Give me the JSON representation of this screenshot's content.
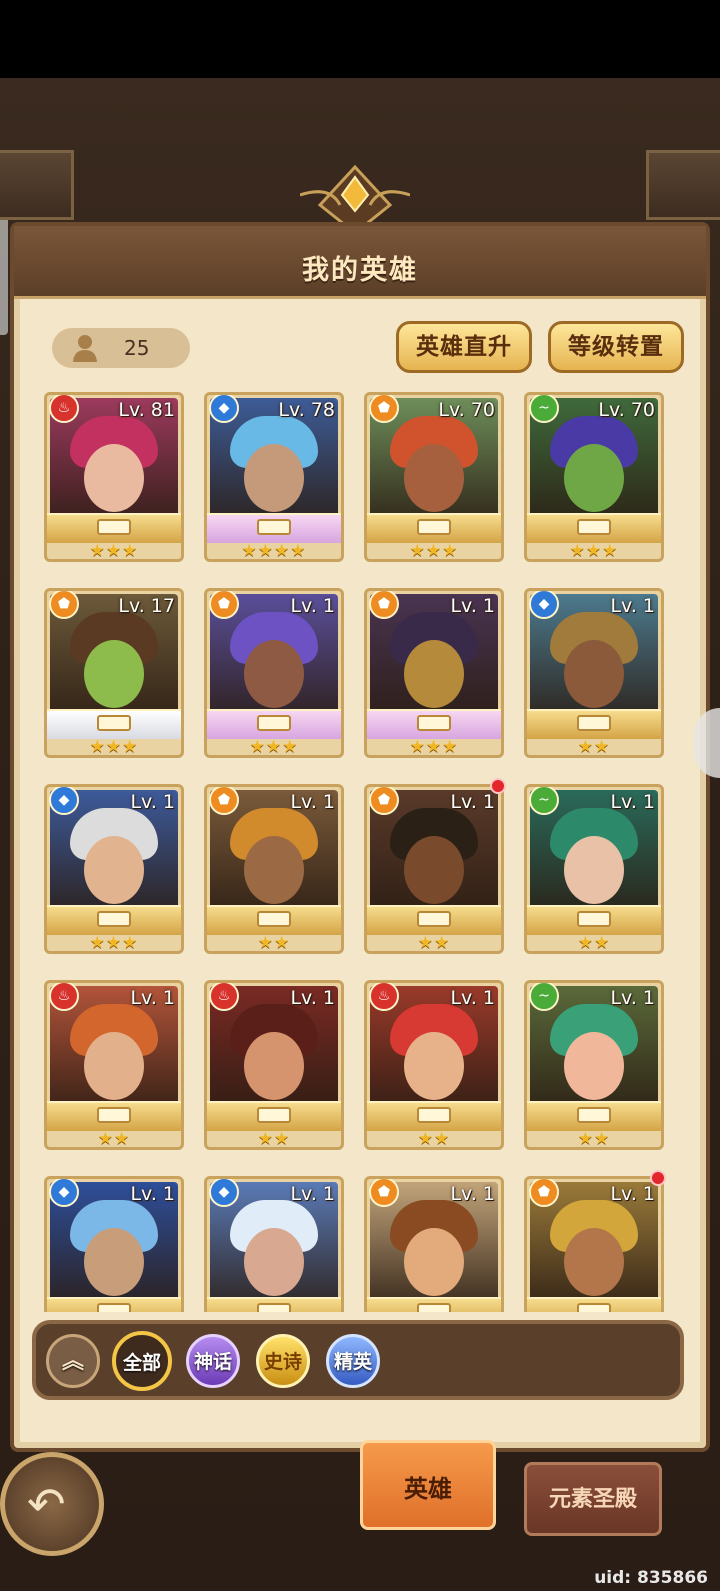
{
  "header": {
    "title": "我的英雄"
  },
  "roster": {
    "count": "25"
  },
  "actions": {
    "direct_upgrade": "英雄直升",
    "level_transfer": "等级转置"
  },
  "heroes": [
    {
      "level": "Lv. 81",
      "element": "fire",
      "stars": "★★★",
      "base": "gold",
      "colors": {
        "bg": "#9c3a5d",
        "hair": "#c2315f",
        "skin": "#e9b9a0"
      }
    },
    {
      "level": "Lv. 78",
      "element": "water",
      "stars": "★★★★",
      "base": "pink",
      "colors": {
        "bg": "#3d5c97",
        "hair": "#68b9e6",
        "skin": "#c49a7a"
      }
    },
    {
      "level": "Lv. 70",
      "element": "light",
      "stars": "★★★",
      "base": "gold",
      "colors": {
        "bg": "#6e8e5a",
        "hair": "#d0532e",
        "skin": "#a7603e"
      }
    },
    {
      "level": "Lv. 70",
      "element": "wind",
      "stars": "★★★",
      "base": "gold",
      "colors": {
        "bg": "#3f6a3c",
        "hair": "#4a3aa5",
        "skin": "#6fa746"
      }
    },
    {
      "level": "Lv. 17",
      "element": "light",
      "stars": "★★★",
      "base": "white",
      "colors": {
        "bg": "#6d5a3a",
        "hair": "#5a3a22",
        "skin": "#8dbb4c"
      }
    },
    {
      "level": "Lv. 1",
      "element": "light",
      "stars": "★★★",
      "base": "pink",
      "colors": {
        "bg": "#5a4f9a",
        "hair": "#6d52c4",
        "skin": "#8e5a43"
      }
    },
    {
      "level": "Lv. 1",
      "element": "light",
      "stars": "★★★",
      "base": "pink",
      "colors": {
        "bg": "#4a3452",
        "hair": "#3a2a4a",
        "skin": "#b58a3a"
      }
    },
    {
      "level": "Lv. 1",
      "element": "water",
      "stars": "★★",
      "base": "gold",
      "colors": {
        "bg": "#4c7a8e",
        "hair": "#a07b3c",
        "skin": "#8a5a3a"
      }
    },
    {
      "level": "Lv. 1",
      "element": "water",
      "stars": "★★★",
      "base": "gold",
      "colors": {
        "bg": "#3d5a9a",
        "hair": "#dcdcdc",
        "skin": "#e1b38f"
      }
    },
    {
      "level": "Lv. 1",
      "element": "light",
      "stars": "★★",
      "base": "gold",
      "colors": {
        "bg": "#7a5a3a",
        "hair": "#d18a2c",
        "skin": "#9b6a45"
      }
    },
    {
      "level": "Lv. 1",
      "element": "light",
      "stars": "★★",
      "base": "gold",
      "colors": {
        "bg": "#5a3a2a",
        "hair": "#2a2016",
        "skin": "#7a4a2c"
      },
      "alert": true
    },
    {
      "level": "Lv. 1",
      "element": "wind",
      "stars": "★★",
      "base": "gold",
      "colors": {
        "bg": "#2a6a5a",
        "hair": "#2c8a6a",
        "skin": "#e9c1a6"
      }
    },
    {
      "level": "Lv. 1",
      "element": "fire",
      "stars": "★★",
      "base": "gold",
      "colors": {
        "bg": "#b2543a",
        "hair": "#d2662c",
        "skin": "#e2b08a"
      }
    },
    {
      "level": "Lv. 1",
      "element": "fire",
      "stars": "★★",
      "base": "gold",
      "colors": {
        "bg": "#7a2a24",
        "hair": "#5a1f18",
        "skin": "#d6946e"
      }
    },
    {
      "level": "Lv. 1",
      "element": "fire",
      "stars": "★★",
      "base": "gold",
      "colors": {
        "bg": "#9a3a2a",
        "hair": "#d63a32",
        "skin": "#e7b28a"
      }
    },
    {
      "level": "Lv. 1",
      "element": "wind",
      "stars": "★★",
      "base": "gold",
      "colors": {
        "bg": "#5a6a3a",
        "hair": "#3aa078",
        "skin": "#f0b79a"
      }
    },
    {
      "level": "Lv. 1",
      "element": "water",
      "stars": "",
      "base": "gold",
      "colors": {
        "bg": "#2e4e9a",
        "hair": "#7bb8e8",
        "skin": "#c79d7a"
      }
    },
    {
      "level": "Lv. 1",
      "element": "water",
      "stars": "",
      "base": "gold",
      "colors": {
        "bg": "#5a7ab6",
        "hair": "#e0ecf7",
        "skin": "#d9a891"
      }
    },
    {
      "level": "Lv. 1",
      "element": "light",
      "stars": "",
      "base": "gold",
      "colors": {
        "bg": "#c2a47a",
        "hair": "#8a4a22",
        "skin": "#e3ab7c"
      }
    },
    {
      "level": "Lv. 1",
      "element": "light",
      "stars": "",
      "base": "gold",
      "colors": {
        "bg": "#9a7a3a",
        "hair": "#d2a63a",
        "skin": "#b2764a"
      },
      "alert": true
    }
  ],
  "element_colors": {
    "fire": "#d7322c",
    "water": "#2f79d9",
    "light": "#ee8c22",
    "wind": "#4aab38"
  },
  "filters": {
    "collapse_icon": "double-chevron-up",
    "all": "全部",
    "myth": "神话",
    "epic": "史诗",
    "elite": "精英"
  },
  "tabs": {
    "heroes": "英雄",
    "temple": "元素圣殿"
  },
  "footer": {
    "uid": "uid: 835866"
  },
  "icons": {
    "back": "back-arrow-icon",
    "person": "person-icon"
  }
}
